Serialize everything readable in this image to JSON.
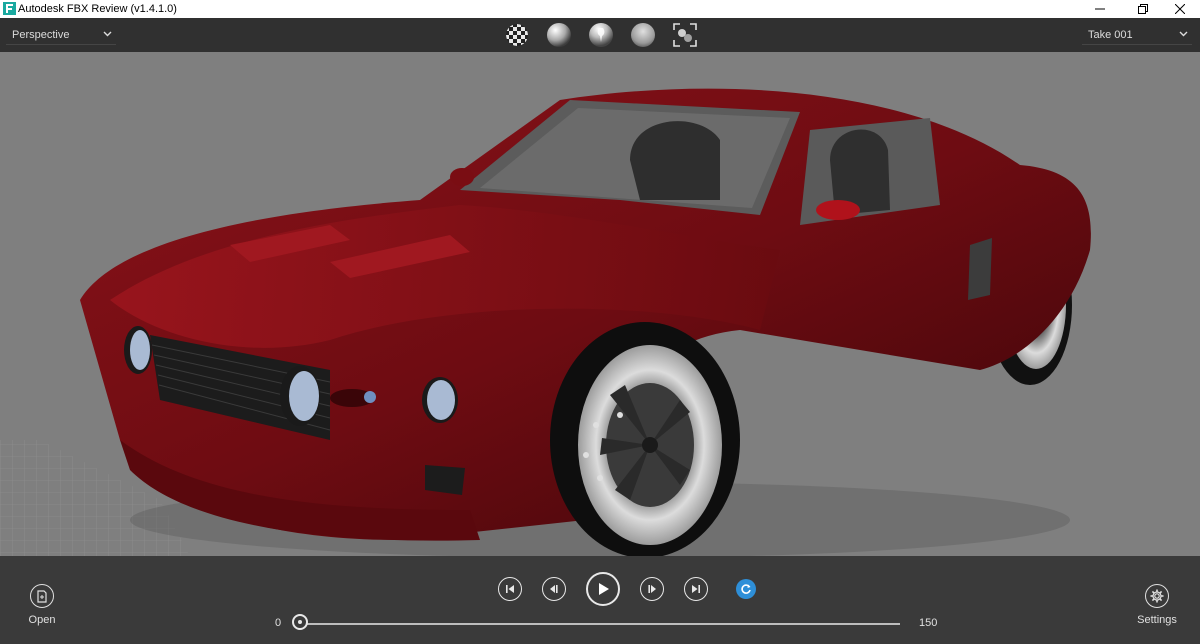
{
  "titlebar": {
    "title": "Autodesk FBX Review (v1.4.1.0)",
    "icon": "fbx-app-icon",
    "controls": [
      "minimize-icon",
      "restore-icon",
      "close-icon"
    ]
  },
  "toolbar": {
    "camera": "Perspective",
    "shading_modes": [
      "checker-shading-icon",
      "smooth-shading-icon",
      "lit-shading-icon",
      "flat-shading-icon",
      "frame-all-icon"
    ],
    "take": "Take 001"
  },
  "viewport": {
    "background": "#7f7f7f",
    "model_color": "#7a0f14",
    "content": "red-sports-car-model"
  },
  "bottombar": {
    "open_label": "Open",
    "settings_label": "Settings",
    "transport": [
      "go-to-start-icon",
      "step-back-icon",
      "play-icon",
      "step-forward-icon",
      "go-to-end-icon",
      "loop-icon"
    ],
    "timeline_start": "0",
    "timeline_end": "150",
    "current_frame_fraction": 0
  },
  "colors": {
    "toolbar_bg": "#303030",
    "bottombar_bg": "#3a3a3a",
    "accent": "#2e8fd8"
  }
}
